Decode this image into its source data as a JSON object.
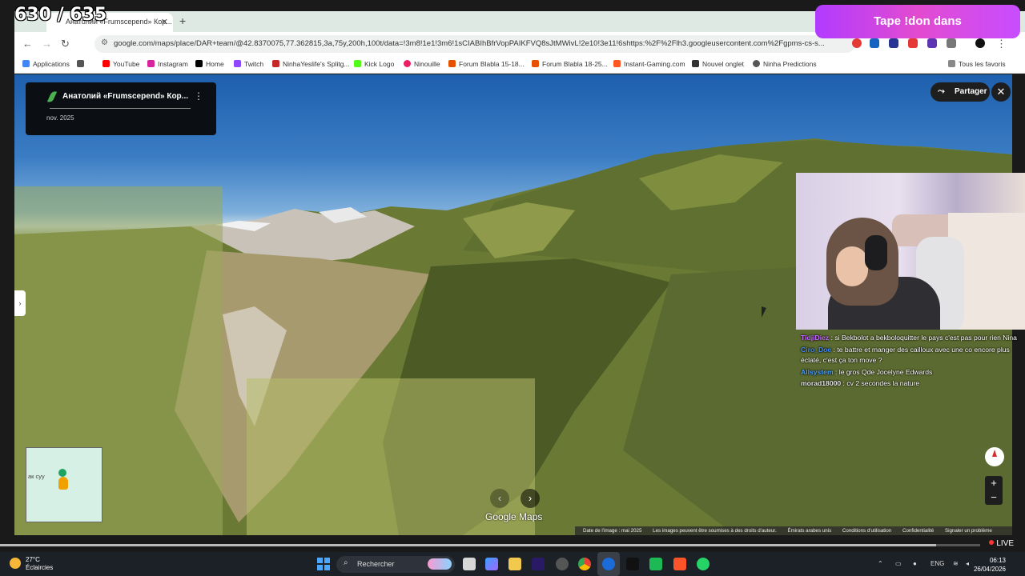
{
  "overlay": {
    "counter": "630 / 635",
    "donation_banner": "Tape !don dans",
    "live_label": "LIVE",
    "stream_progress": 0.955
  },
  "browser": {
    "tab_title": "Анатолий «Frumscepend» Кор...",
    "url": "google.com/maps/place/DAR+team/@42.8370075,77.362815,3a,75y,200h,100t/data=!3m8!1e1!3m6!1sCIABIhBfrVopPAIKFVQ8sJtMWivL!2e10!3e11!6shttps:%2F%2Flh3.googleusercontent.com%2Fgpms-cs-s...",
    "bookmarks": [
      {
        "label": "Applications",
        "icon": "apps-icon",
        "color": "#4285f4"
      },
      {
        "label": "",
        "icon": "grid-icon",
        "color": "#555555"
      },
      {
        "label": "YouTube",
        "icon": "youtube-icon",
        "color": "#ff0000"
      },
      {
        "label": "Instagram",
        "icon": "instagram-icon",
        "color": "#d6249f"
      },
      {
        "label": "Home",
        "icon": "x-icon",
        "color": "#000000"
      },
      {
        "label": "Twitch",
        "icon": "twitch-icon",
        "color": "#9146ff"
      },
      {
        "label": "NinhaYeslife's Splitg...",
        "icon": "splitgate-icon",
        "color": "#c62828"
      },
      {
        "label": "Kick Logo",
        "icon": "kick-icon",
        "color": "#53fc18"
      },
      {
        "label": "Ninouille",
        "icon": "ninouille-icon",
        "color": "#e91e63"
      },
      {
        "label": "Forum Blabla 15-18...",
        "icon": "jvc-icon",
        "color": "#e65100"
      },
      {
        "label": "Forum Blabla 18-25...",
        "icon": "jvc-icon",
        "color": "#e65100"
      },
      {
        "label": "Instant-Gaming.com",
        "icon": "instant-gaming-icon",
        "color": "#ff5722"
      },
      {
        "label": "Nouvel onglet",
        "icon": "page-icon",
        "color": "#333333"
      },
      {
        "label": "Ninha Predictions",
        "icon": "globe-icon",
        "color": "#555555"
      }
    ],
    "all_bookmarks": "Tous les favoris"
  },
  "streetview": {
    "info_title": "Анатолий «Frumscepend» Кор...",
    "info_date": "nov. 2025",
    "share_label": "Partager",
    "brand": "Google Maps",
    "minimap_label": "ак суу",
    "footer": {
      "image_date": "Date de l'image : mai 2025",
      "rights": "Les images peuvent être soumises à des droits d'auteur.",
      "region": "Émirats arabes unis",
      "terms": "Conditions d'utilisation",
      "privacy": "Confidentialité",
      "report": "Signaler un problème"
    }
  },
  "chat": [
    {
      "user": "TidjiDiez",
      "color": "#c86cff",
      "text": "si Bekbolot a bekboloquitter le pays c'est pas pour rien Nina"
    },
    {
      "user": "Ciro_Doe",
      "color": "#3f8cff",
      "text": "te battre et manger des cailloux avec une co encore plus éclaté, c'est ça ton move ?"
    },
    {
      "user": "Allsystem",
      "color": "#4aa3ff",
      "text": "le gros Qde Jocelyne Edwards"
    },
    {
      "user": "morad18000",
      "color": "#e8e8e8",
      "text": "cv 2 secondes la nature"
    }
  ],
  "taskbar": {
    "weather_temp": "27°C",
    "weather_desc": "Éclaircies",
    "search_placeholder": "Rechercher",
    "lang": "ENG",
    "time": "06:13",
    "date": "26/04/2026"
  }
}
